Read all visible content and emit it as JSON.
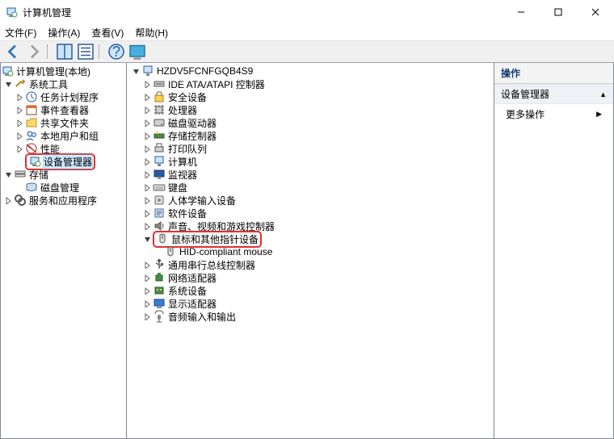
{
  "window": {
    "title": "计算机管理",
    "min": "–",
    "max": "□",
    "close": "×"
  },
  "menu": {
    "file": "文件(F)",
    "action": "操作(A)",
    "view": "查看(V)",
    "help": "帮助(H)"
  },
  "leftTree": {
    "root": "计算机管理(本地)",
    "sysTools": "系统工具",
    "taskSched": "任务计划程序",
    "eventViewer": "事件查看器",
    "sharedFolders": "共享文件夹",
    "localUsers": "本地用户和组",
    "performance": "性能",
    "deviceMgr": "设备管理器",
    "storage": "存储",
    "diskMgmt": "磁盘管理",
    "services": "服务和应用程序"
  },
  "devTree": {
    "root": "HZDV5FCNFGQB4S9",
    "ide": "IDE ATA/ATAPI 控制器",
    "security": "安全设备",
    "cpu": "处理器",
    "disk": "磁盘驱动器",
    "storageCtrl": "存储控制器",
    "printQueue": "打印队列",
    "computer": "计算机",
    "monitor": "监视器",
    "keyboard": "键盘",
    "hid": "人体学输入设备",
    "software": "软件设备",
    "avgame": "声音、视频和游戏控制器",
    "mouse": "鼠标和其他指针设备",
    "hidMouse": "HID-compliant mouse",
    "usb": "通用串行总线控制器",
    "network": "网络适配器",
    "sysdev": "系统设备",
    "display": "显示适配器",
    "audio": "音频输入和输出"
  },
  "actions": {
    "header": "操作",
    "section": "设备管理器",
    "more": "更多操作"
  }
}
